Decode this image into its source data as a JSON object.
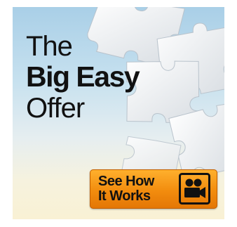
{
  "ad": {
    "headline": {
      "line1": "The",
      "line2": "Big Easy",
      "line3": "Offer"
    },
    "cta": {
      "line1": "See How",
      "line2": "It Works",
      "icon": "video-camera-icon"
    },
    "colors": {
      "cta_orange": "#f28c0e",
      "sky_blue": "#a9cfe7",
      "cream": "#f9f1d4",
      "text": "#111111"
    }
  }
}
